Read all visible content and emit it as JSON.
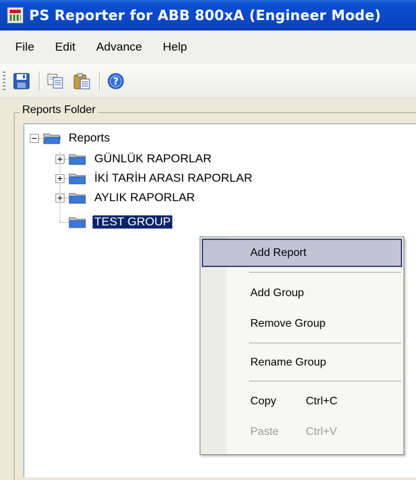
{
  "window": {
    "title": "PS Reporter for ABB 800xA (Engineer Mode)"
  },
  "menubar": {
    "items": [
      "File",
      "Edit",
      "Advance",
      "Help"
    ]
  },
  "toolbar": {
    "icons": [
      "save-icon",
      "copy-icon",
      "paste-icon",
      "help-icon"
    ]
  },
  "reports_folder": {
    "label": "Reports Folder",
    "tree": {
      "root": "Reports",
      "children": [
        "GÜNLÜK RAPORLAR",
        "İKİ TARİH ARASI RAPORLAR",
        "AYLIK RAPORLAR",
        "TEST GROUP"
      ],
      "selected": "TEST GROUP"
    }
  },
  "context_menu": {
    "add_report": "Add Report",
    "add_group": "Add Group",
    "remove_group": "Remove Group",
    "rename_group": "Rename Group",
    "copy": {
      "label": "Copy",
      "shortcut": "Ctrl+C"
    },
    "paste": {
      "label": "Paste",
      "shortcut": "Ctrl+V"
    }
  },
  "colors": {
    "titlebar": "#0a48c8",
    "selection": "#0a246a",
    "menu_hover": "#c2c4d6"
  }
}
